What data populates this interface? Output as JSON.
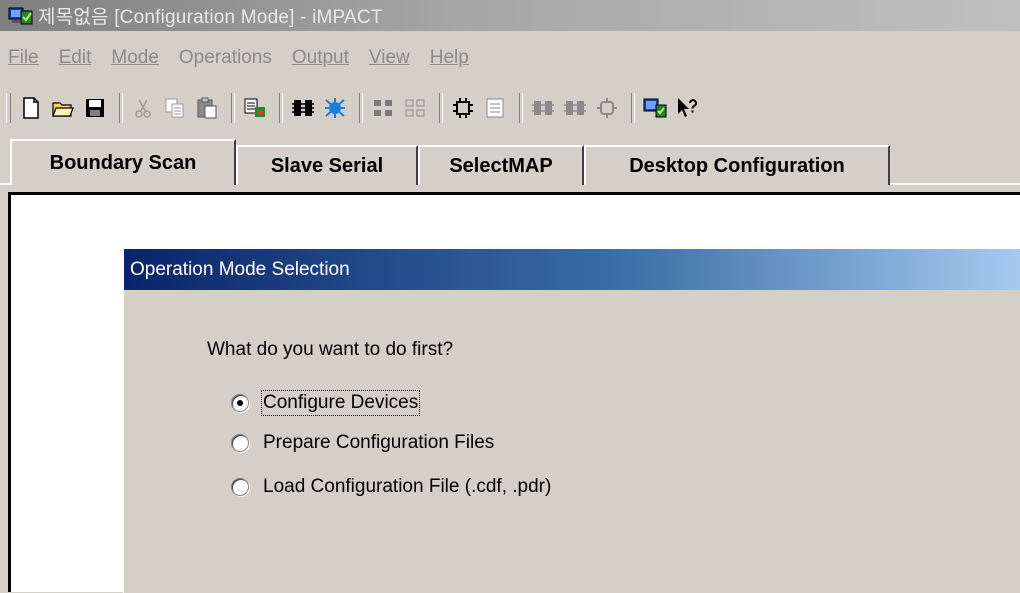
{
  "window": {
    "title": "제목없음 [Configuration Mode]  - iMPACT",
    "icon": "impact-app-icon"
  },
  "menu": {
    "items": [
      {
        "label": "File"
      },
      {
        "label": "Edit"
      },
      {
        "label": "Mode"
      },
      {
        "label": "Operations"
      },
      {
        "label": "Output"
      },
      {
        "label": "View"
      },
      {
        "label": "Help"
      }
    ]
  },
  "toolbar": {
    "buttons": [
      "new-file-icon",
      "open-folder-icon",
      "save-icon",
      "cut-icon",
      "copy-icon",
      "paste-icon",
      "assign-file-icon",
      "chain-icon",
      "debug-chain-icon",
      "grid-icon",
      "grid-outline-icon",
      "chip-icon",
      "list-icon",
      "program-icon",
      "verify-icon",
      "erase-icon",
      "cable-setup-icon",
      "context-help-icon"
    ]
  },
  "tabs": [
    {
      "label": "Boundary Scan",
      "active": true
    },
    {
      "label": "Slave Serial",
      "active": false
    },
    {
      "label": "SelectMAP",
      "active": false
    },
    {
      "label": "Desktop Configuration",
      "active": false
    }
  ],
  "dialog": {
    "title": "Operation Mode Selection",
    "question": "What do you want to do first?",
    "options": [
      {
        "label": "Configure Devices",
        "selected": true
      },
      {
        "label": "Prepare Configuration Files",
        "selected": false
      },
      {
        "label": "Load Configuration File (.cdf, .pdr)",
        "selected": false
      }
    ]
  },
  "colors": {
    "dialog_title_start": "#0a246a",
    "dialog_title_end": "#a6caf0",
    "chrome": "#d4d0c8"
  }
}
